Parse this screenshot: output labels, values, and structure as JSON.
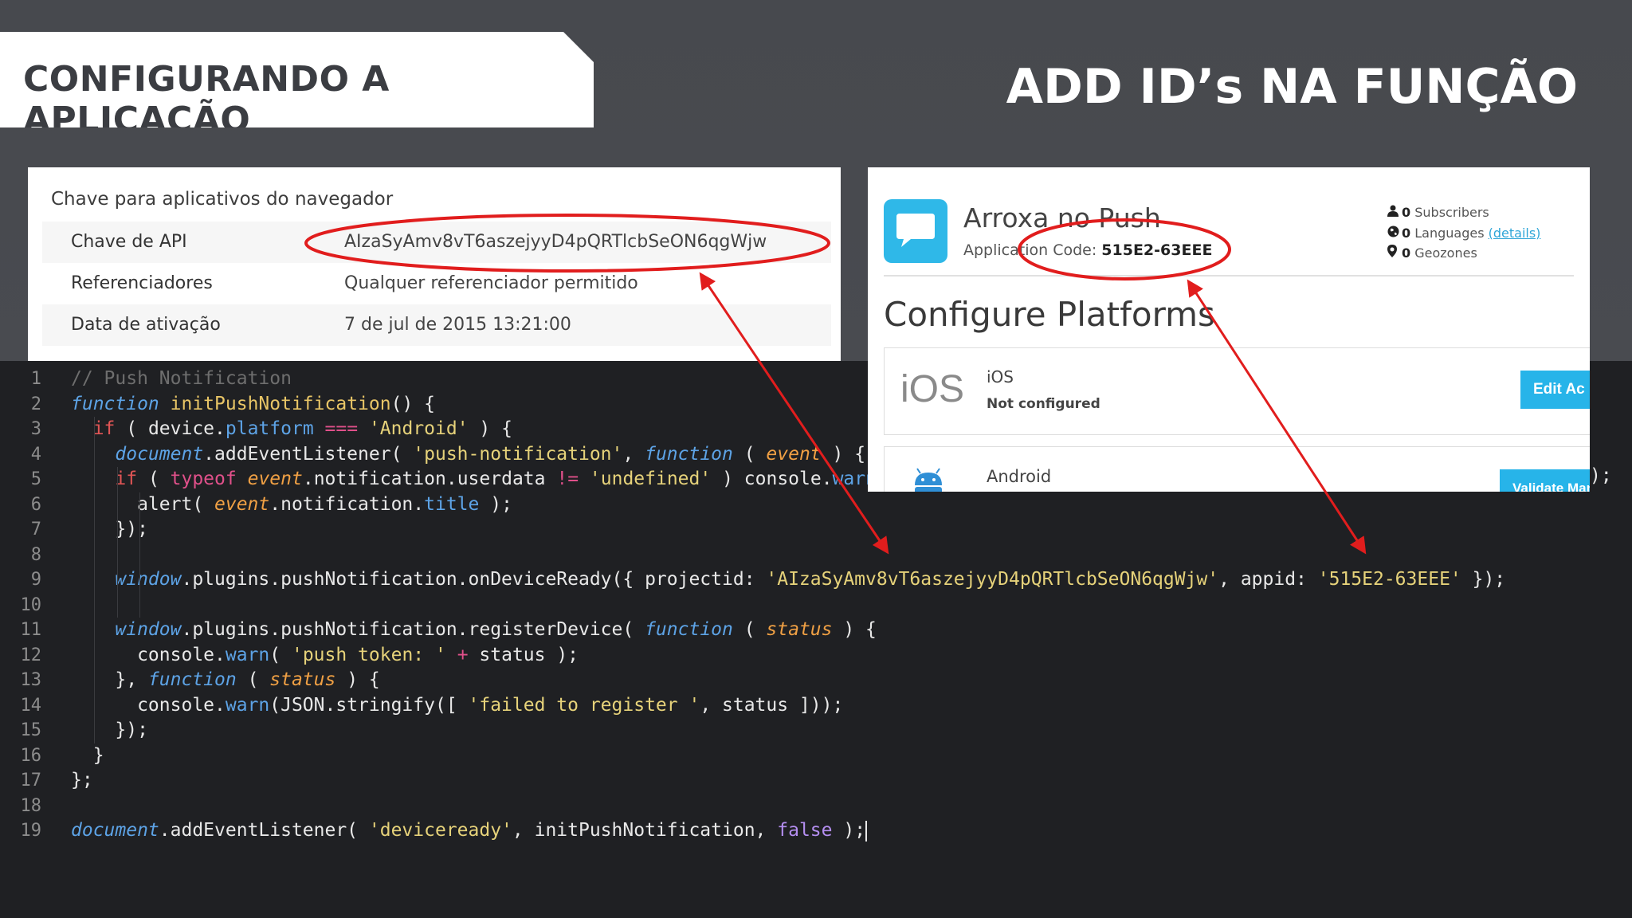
{
  "slide": {
    "title": "CONFIGURANDO A APLICAÇÃO",
    "subtitle": "ADD ID’s NA FUNÇÃO"
  },
  "api_panel": {
    "heading": "Chave para aplicativos do navegador",
    "rows": [
      {
        "label": "Chave de API",
        "value": "AIzaSyAmv8vT6aszejyyD4pQRTlcbSeON6qgWjw"
      },
      {
        "label": "Referenciadores",
        "value": "Qualquer referenciador permitido"
      },
      {
        "label": "Data de ativação",
        "value": "7 de jul de 2015 13:21:00"
      }
    ]
  },
  "push_panel": {
    "app_name": "Arroxa no Push",
    "app_code_label": "Application Code:",
    "app_code": "515E2-63EEE",
    "stats": {
      "subscribers_count": "0",
      "subscribers_label": "Subscribers",
      "languages_count": "0",
      "languages_label": "Languages",
      "details_link": "(details)",
      "geozones_count": "0",
      "geozones_label": "Geozones"
    },
    "section_title": "Configure Platforms",
    "ios": {
      "logo_text": "iOS",
      "name": "iOS",
      "status": "Not configured",
      "button": "Edit Ac"
    },
    "android": {
      "name": "Android",
      "button": "Validate Man"
    }
  },
  "editor": {
    "line_numbers": [
      "1",
      "2",
      "3",
      "4",
      "5",
      "6",
      "7",
      "8",
      "9",
      "10",
      "11",
      "12",
      "13",
      "14",
      "15",
      "16",
      "17",
      "18",
      "19"
    ],
    "overflow_fragment": ");",
    "lines": [
      [
        [
          "cm",
          "// Push Notification"
        ]
      ],
      [
        [
          "kw",
          "function"
        ],
        [
          "p",
          " "
        ],
        [
          "fn",
          "initPushNotification"
        ],
        [
          "p",
          "() {"
        ]
      ],
      [
        [
          "p",
          "  "
        ],
        [
          "ctl",
          "if"
        ],
        [
          "p",
          " ( device."
        ],
        [
          "prop",
          "platform"
        ],
        [
          "p",
          " "
        ],
        [
          "op",
          "==="
        ],
        [
          "p",
          " "
        ],
        [
          "str",
          "'Android'"
        ],
        [
          "p",
          " ) {"
        ]
      ],
      [
        [
          "p",
          "    "
        ],
        [
          "kw",
          "document"
        ],
        [
          "p",
          ".addEventListener( "
        ],
        [
          "str",
          "'push-notification'"
        ],
        [
          "p",
          ", "
        ],
        [
          "kw",
          "function"
        ],
        [
          "p",
          " ( "
        ],
        [
          "par",
          "event"
        ],
        [
          "p",
          " ) {"
        ]
      ],
      [
        [
          "p",
          "    "
        ],
        [
          "ctl",
          "if"
        ],
        [
          "p",
          " ( "
        ],
        [
          "op",
          "typeof"
        ],
        [
          "p",
          " "
        ],
        [
          "par",
          "event"
        ],
        [
          "p",
          ".notification.userdata "
        ],
        [
          "op",
          "!="
        ],
        [
          "p",
          " "
        ],
        [
          "str",
          "'undefined'"
        ],
        [
          "p",
          " ) console."
        ],
        [
          "prop",
          "warn"
        ]
      ],
      [
        [
          "p",
          "      alert( "
        ],
        [
          "par",
          "event"
        ],
        [
          "p",
          ".notification."
        ],
        [
          "prop",
          "title"
        ],
        [
          "p",
          " );"
        ]
      ],
      [
        [
          "p",
          "    });"
        ]
      ],
      [
        [
          "p",
          ""
        ]
      ],
      [
        [
          "p",
          "    "
        ],
        [
          "kw",
          "window"
        ],
        [
          "p",
          ".plugins.pushNotification.onDeviceReady({ projectid: "
        ],
        [
          "str",
          "'AIzaSyAmv8vT6aszejyyD4pQRTlcbSeON6qgWjw'"
        ],
        [
          "p",
          ", appid: "
        ],
        [
          "str",
          "'515E2-63EEE'"
        ],
        [
          "p",
          " });"
        ]
      ],
      [
        [
          "p",
          ""
        ]
      ],
      [
        [
          "p",
          "    "
        ],
        [
          "kw",
          "window"
        ],
        [
          "p",
          ".plugins.pushNotification.registerDevice( "
        ],
        [
          "kw",
          "function"
        ],
        [
          "p",
          " ( "
        ],
        [
          "par",
          "status"
        ],
        [
          "p",
          " ) {"
        ]
      ],
      [
        [
          "p",
          "      console."
        ],
        [
          "prop",
          "warn"
        ],
        [
          "p",
          "( "
        ],
        [
          "str",
          "'push token: '"
        ],
        [
          "p",
          " "
        ],
        [
          "op",
          "+"
        ],
        [
          "p",
          " status );"
        ]
      ],
      [
        [
          "p",
          "    }, "
        ],
        [
          "kw",
          "function"
        ],
        [
          "p",
          " ( "
        ],
        [
          "par",
          "status"
        ],
        [
          "p",
          " ) {"
        ]
      ],
      [
        [
          "p",
          "      console."
        ],
        [
          "prop",
          "warn"
        ],
        [
          "p",
          "(JSON.stringify([ "
        ],
        [
          "str",
          "'failed to register '"
        ],
        [
          "p",
          ", status ]));"
        ]
      ],
      [
        [
          "p",
          "    });"
        ]
      ],
      [
        [
          "p",
          "  }"
        ]
      ],
      [
        [
          "p",
          "};"
        ]
      ],
      [
        [
          "p",
          ""
        ]
      ],
      [
        [
          "kw",
          "document"
        ],
        [
          "p",
          ".addEventListener( "
        ],
        [
          "str",
          "'deviceready'"
        ],
        [
          "p",
          ", initPushNotification, "
        ],
        [
          "bool",
          "false"
        ],
        [
          "p",
          " );"
        ]
      ]
    ]
  }
}
